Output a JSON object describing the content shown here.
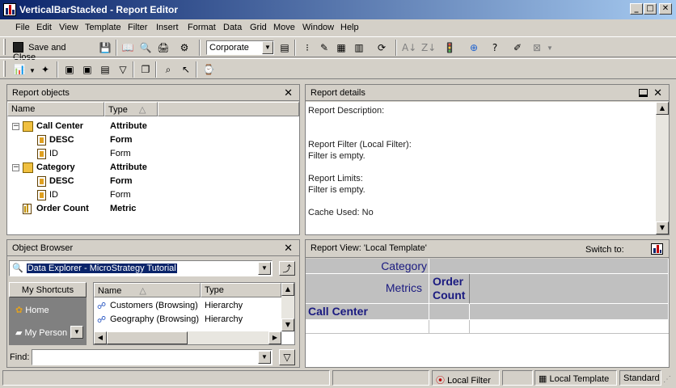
{
  "window": {
    "title": "VerticalBarStacked - Report Editor",
    "controls": {
      "minimize": "_",
      "maximize": "□",
      "close": "✕"
    }
  },
  "menu": [
    "File",
    "Edit",
    "View",
    "Template",
    "Filter",
    "Insert",
    "Format",
    "Data",
    "Grid",
    "Move",
    "Window",
    "Help"
  ],
  "toolbar": {
    "save_close_label": "Save and Close",
    "template_select": "Corporate"
  },
  "report_objects": {
    "title": "Report objects",
    "col_name": "Name",
    "col_type": "Type",
    "rows": [
      {
        "name": "Call Center",
        "type": "Attribute",
        "bold": true
      },
      {
        "name": "DESC",
        "type": "Form",
        "bold": true
      },
      {
        "name": "ID",
        "type": "Form",
        "bold": false
      },
      {
        "name": "Category",
        "type": "Attribute",
        "bold": true
      },
      {
        "name": "DESC",
        "type": "Form",
        "bold": true
      },
      {
        "name": "ID",
        "type": "Form",
        "bold": false
      },
      {
        "name": "Order Count",
        "type": "Metric",
        "bold": true
      }
    ]
  },
  "report_details": {
    "title": "Report details",
    "description_label": "Report Description:",
    "filter_label": "Report Filter (Local Filter):",
    "filter_value": "Filter is empty.",
    "limits_label": "Report Limits:",
    "limits_value": "Filter is empty.",
    "cache_label": "Cache Used: No"
  },
  "object_browser": {
    "title": "Object Browser",
    "source": "Data Explorer - MicroStrategy Tutorial",
    "shortcuts_button": "My Shortcuts",
    "shortcuts": [
      "Home",
      "My Person"
    ],
    "col_name": "Name",
    "col_type": "Type",
    "items": [
      {
        "name": "Customers (Browsing)",
        "type": "Hierarchy"
      },
      {
        "name": "Geography (Browsing)",
        "type": "Hierarchy"
      }
    ],
    "find_label": "Find:"
  },
  "report_view": {
    "title": "Report View: 'Local Template'",
    "switch_to": "Switch to:",
    "category": "Category",
    "metrics": "Metrics",
    "metric_header": "Order Count",
    "row_header": "Call Center"
  },
  "status_bar": {
    "local_filter": "Local Filter",
    "local_template": "Local Template",
    "mode": "Standard"
  }
}
